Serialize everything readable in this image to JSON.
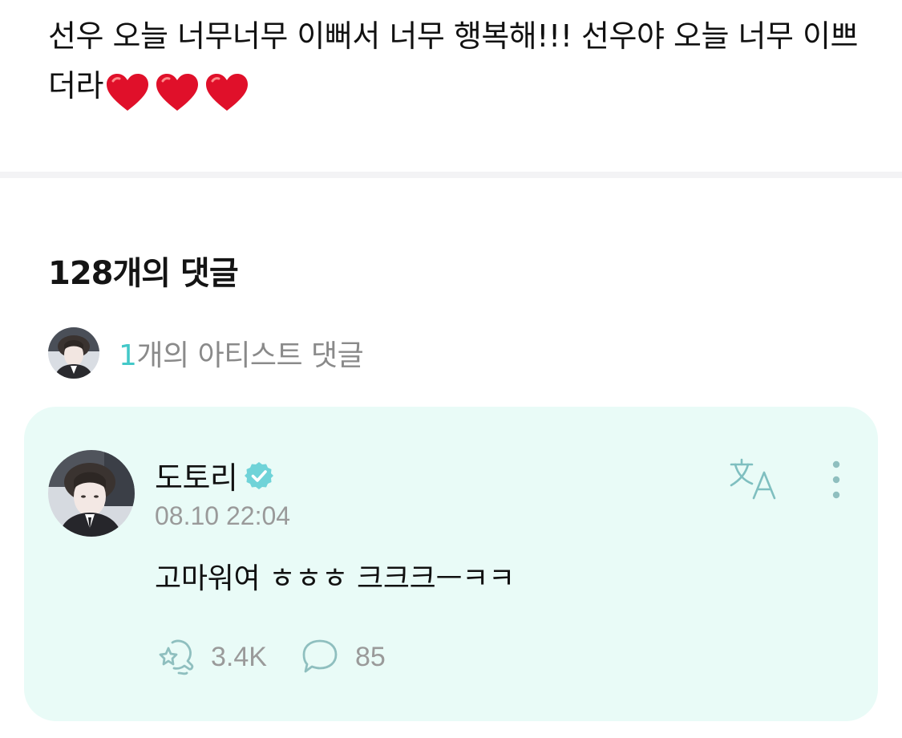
{
  "post": {
    "text": "선우 오늘 너무너무 이뻐서 너무 행복해!!! 선우야 오늘 너무 이쁘더라",
    "heart_emoji_count": 3,
    "heart_color": "#e0102a"
  },
  "comments_section": {
    "title": "128개의 댓글",
    "artist_count": "1",
    "artist_label": "개의 아티스트 댓글",
    "accent_color": "#43c8c8"
  },
  "artist_comment": {
    "author": "도토리",
    "verified_icon": "verified-badge-icon",
    "timestamp": "08.10 22:04",
    "body": "고마워여 ㅎㅎㅎ 크크크ㅡㅋㅋ",
    "translate_icon": "translate-icon",
    "more_icon": "more-vertical-icon",
    "like_icon": "reaction-icon",
    "like_count": "3.4K",
    "reply_icon": "comment-bubble-icon",
    "reply_count": "85",
    "card_background": "#e9fbf7"
  }
}
